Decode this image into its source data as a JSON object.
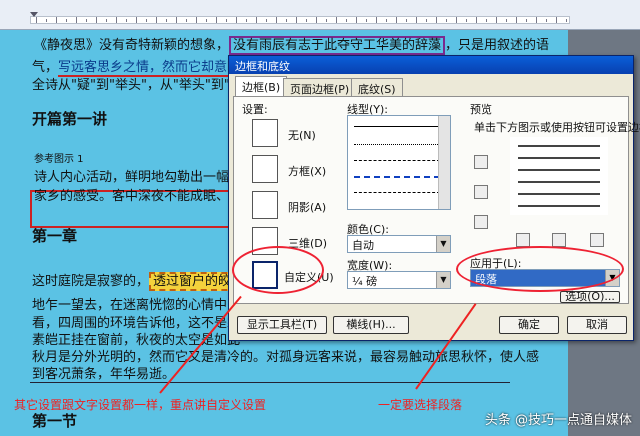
{
  "document": {
    "line1": "《静夜思》没有奇特新颖的想象，",
    "line1_box": "没有雨辰有志于此夺守工华美的辞藻",
    "line1_end": "，只是用叙述的语",
    "line2": "气，",
    "line2_ul": "写远客思乡之情，然而它却意味",
    "line3": "全诗从\"疑\"到\"举头\"，从\"举头\"到\"低",
    "heading1": "开篇第一讲",
    "ref_label": "参考图示 1",
    "quote1": "诗人内心活动，鲜明地勾勒出一幅生",
    "quote2": "家乡的感受。客中深夜不能成眠、短",
    "heading2": "第一章",
    "p1_start": "这时庭院是寂寥的，",
    "p1_hl": "透过窗户的皎洁",
    "p2": "地乍一望去，在迷离恍惚的心情中，",
    "p3": "看，四周围的环境告诉他，这不是霜",
    "p4": "素皑正挂在窗前，秋夜的太空是如此",
    "p5": "秋月是分外光明的，然而它又是清冷的。对孤身远客来说，最容易触动旅思秋怀，使人感",
    "p6": "到客况萧条，年华易逝。",
    "heading3": "第一节"
  },
  "dialog": {
    "title": "边框和底纹",
    "tabs": [
      "边框(B)",
      "页面边框(P)",
      "底纹(S)"
    ],
    "settings_label": "设置:",
    "settings": [
      "无(N)",
      "方框(X)",
      "阴影(A)",
      "三维(D)",
      "自定义(U)"
    ],
    "style_label": "线型(Y):",
    "color_label": "颜色(C):",
    "color_value": "自动",
    "width_label": "宽度(W):",
    "width_value": "¼ 磅",
    "preview_label": "预览",
    "preview_hint": "单击下方图示或使用按钮可设置边框",
    "apply_label": "应用于(L):",
    "apply_value": "段落",
    "options_button": "选项(O)...",
    "toolbar_button": "显示工具栏(T)",
    "hline_button": "横线(H)...",
    "ok_button": "确定",
    "cancel_button": "取消"
  },
  "annotations": {
    "left": "其它设置跟文字设置都一样，重点讲自定义设置",
    "right": "一定要选择段落"
  },
  "watermark": "头条 @技巧一点通自媒体",
  "colors": {
    "annotation": "#e22222",
    "document_bg": "#5bc2e4",
    "title_bar": "#0a5fd8"
  }
}
